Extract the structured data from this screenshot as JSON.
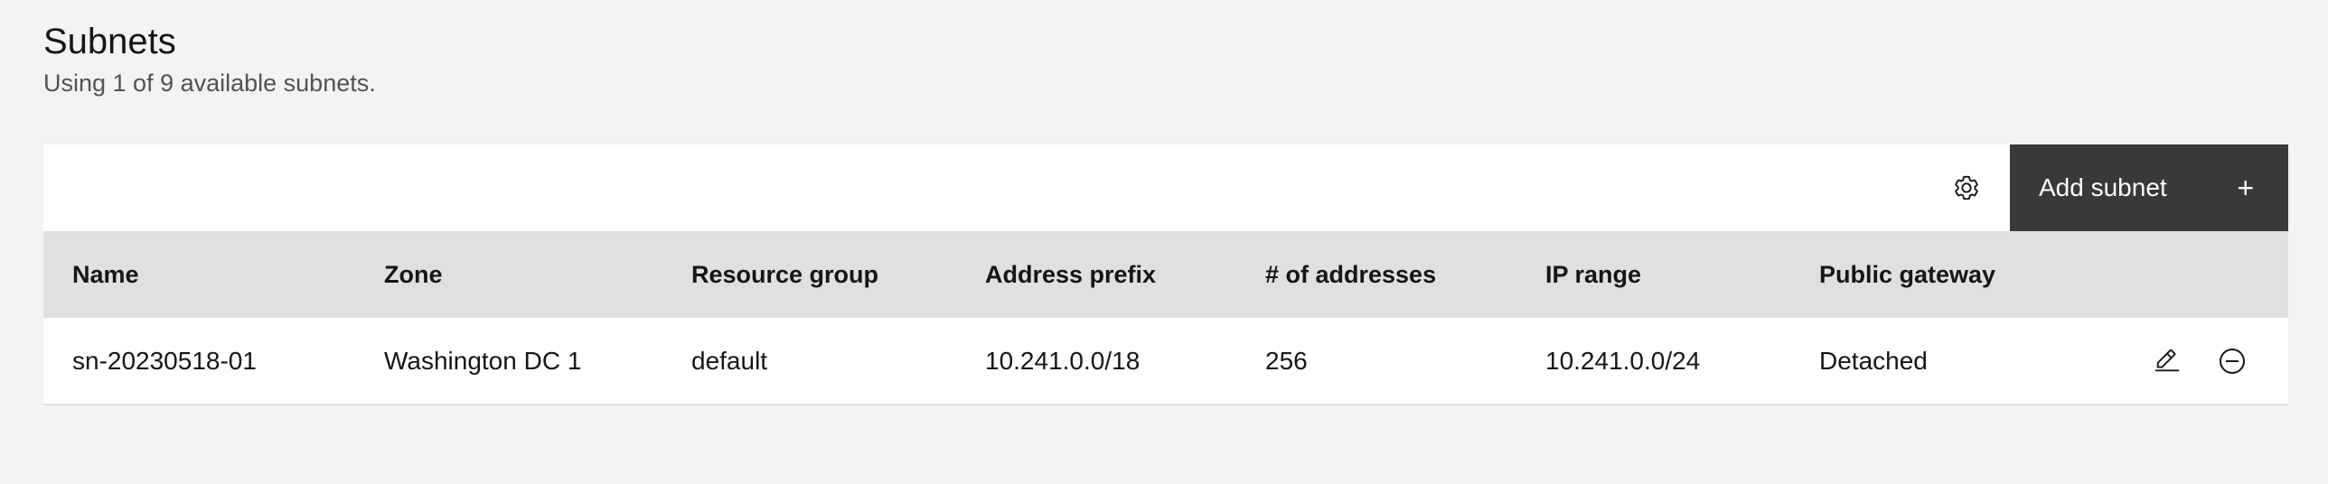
{
  "header": {
    "title": "Subnets",
    "subtitle": "Using 1 of 9 available subnets."
  },
  "toolbar": {
    "settings_icon": "gear-icon",
    "add_label": "Add subnet",
    "add_icon": "plus-icon",
    "add_icon_glyph": "+",
    "add_button_color": "#393939"
  },
  "table": {
    "columns": [
      "Name",
      "Zone",
      "Resource group",
      "Address prefix",
      "# of addresses",
      "IP range",
      "Public gateway"
    ],
    "rows": [
      {
        "name": "sn-20230518-01",
        "zone": "Washington DC 1",
        "resource_group": "default",
        "address_prefix": "10.241.0.0/18",
        "addresses": "256",
        "ip_range": "10.241.0.0/24",
        "public_gateway": "Detached",
        "actions": [
          "edit-icon",
          "remove-icon"
        ]
      }
    ]
  },
  "colors": {
    "page_bg": "#f3f3f3",
    "header_row_bg": "#e0e0e0",
    "text": "#161616",
    "muted_text": "#525252"
  }
}
